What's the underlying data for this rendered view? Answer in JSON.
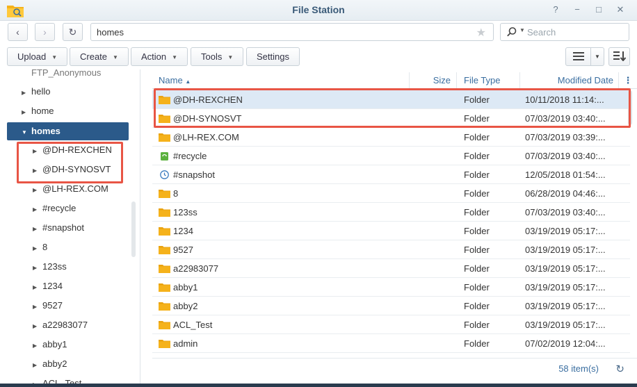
{
  "window": {
    "title": "File Station",
    "help": "?",
    "minimize": "−",
    "maximize": "□",
    "close": "✕"
  },
  "nav": {
    "back": "‹",
    "forward": "›",
    "refresh": "↻"
  },
  "path": {
    "value": "homes"
  },
  "search": {
    "placeholder": "Search"
  },
  "toolbar": {
    "upload": "Upload",
    "create": "Create",
    "action": "Action",
    "tools": "Tools",
    "settings": "Settings"
  },
  "tree": {
    "items": [
      {
        "label": "FTP_Anonymous",
        "level": 1
      },
      {
        "label": "hello",
        "level": 1
      },
      {
        "label": "home",
        "level": 1
      },
      {
        "label": "homes",
        "level": 1,
        "expanded": true,
        "selected": true
      },
      {
        "label": "@DH-REXCHEN",
        "level": 2
      },
      {
        "label": "@DH-SYNOSVT",
        "level": 2
      },
      {
        "label": "@LH-REX.COM",
        "level": 2
      },
      {
        "label": "#recycle",
        "level": 2
      },
      {
        "label": "#snapshot",
        "level": 2
      },
      {
        "label": "8",
        "level": 2
      },
      {
        "label": "123ss",
        "level": 2
      },
      {
        "label": "1234",
        "level": 2
      },
      {
        "label": "9527",
        "level": 2
      },
      {
        "label": "a22983077",
        "level": 2
      },
      {
        "label": "abby1",
        "level": 2
      },
      {
        "label": "abby2",
        "level": 2
      },
      {
        "label": "ACL_Test",
        "level": 2
      }
    ]
  },
  "table": {
    "columns": {
      "name": "Name",
      "size": "Size",
      "type": "File Type",
      "modified": "Modified Date"
    },
    "rows": [
      {
        "name": "@DH-REXCHEN",
        "type": "Folder",
        "modified": "10/11/2018 11:14:...",
        "icon": "folder-icon",
        "selected": true
      },
      {
        "name": "@DH-SYNOSVT",
        "type": "Folder",
        "modified": "07/03/2019 03:40:...",
        "icon": "folder-icon"
      },
      {
        "name": "@LH-REX.COM",
        "type": "Folder",
        "modified": "07/03/2019 03:39:...",
        "icon": "folder-icon"
      },
      {
        "name": "#recycle",
        "type": "Folder",
        "modified": "07/03/2019 03:40:...",
        "icon": "recycle-bin-icon"
      },
      {
        "name": "#snapshot",
        "type": "Folder",
        "modified": "12/05/2018 01:54:...",
        "icon": "snapshot-clock-icon"
      },
      {
        "name": "8",
        "type": "Folder",
        "modified": "06/28/2019 04:46:...",
        "icon": "folder-icon"
      },
      {
        "name": "123ss",
        "type": "Folder",
        "modified": "07/03/2019 03:40:...",
        "icon": "folder-icon"
      },
      {
        "name": "1234",
        "type": "Folder",
        "modified": "03/19/2019 05:17:...",
        "icon": "folder-icon"
      },
      {
        "name": "9527",
        "type": "Folder",
        "modified": "03/19/2019 05:17:...",
        "icon": "folder-icon"
      },
      {
        "name": "a22983077",
        "type": "Folder",
        "modified": "03/19/2019 05:17:...",
        "icon": "folder-icon"
      },
      {
        "name": "abby1",
        "type": "Folder",
        "modified": "03/19/2019 05:17:...",
        "icon": "folder-icon"
      },
      {
        "name": "abby2",
        "type": "Folder",
        "modified": "03/19/2019 05:17:...",
        "icon": "folder-icon"
      },
      {
        "name": "ACL_Test",
        "type": "Folder",
        "modified": "03/19/2019 05:17:...",
        "icon": "folder-icon"
      },
      {
        "name": "admin",
        "type": "Folder",
        "modified": "07/02/2019 12:04:...",
        "icon": "folder-icon"
      }
    ]
  },
  "footer": {
    "count": "58 item(s)"
  },
  "colors": {
    "accent": "#2b5a8a",
    "link": "#3a6ea0",
    "folder": "#f5b21b",
    "highlight": "#e85545"
  }
}
